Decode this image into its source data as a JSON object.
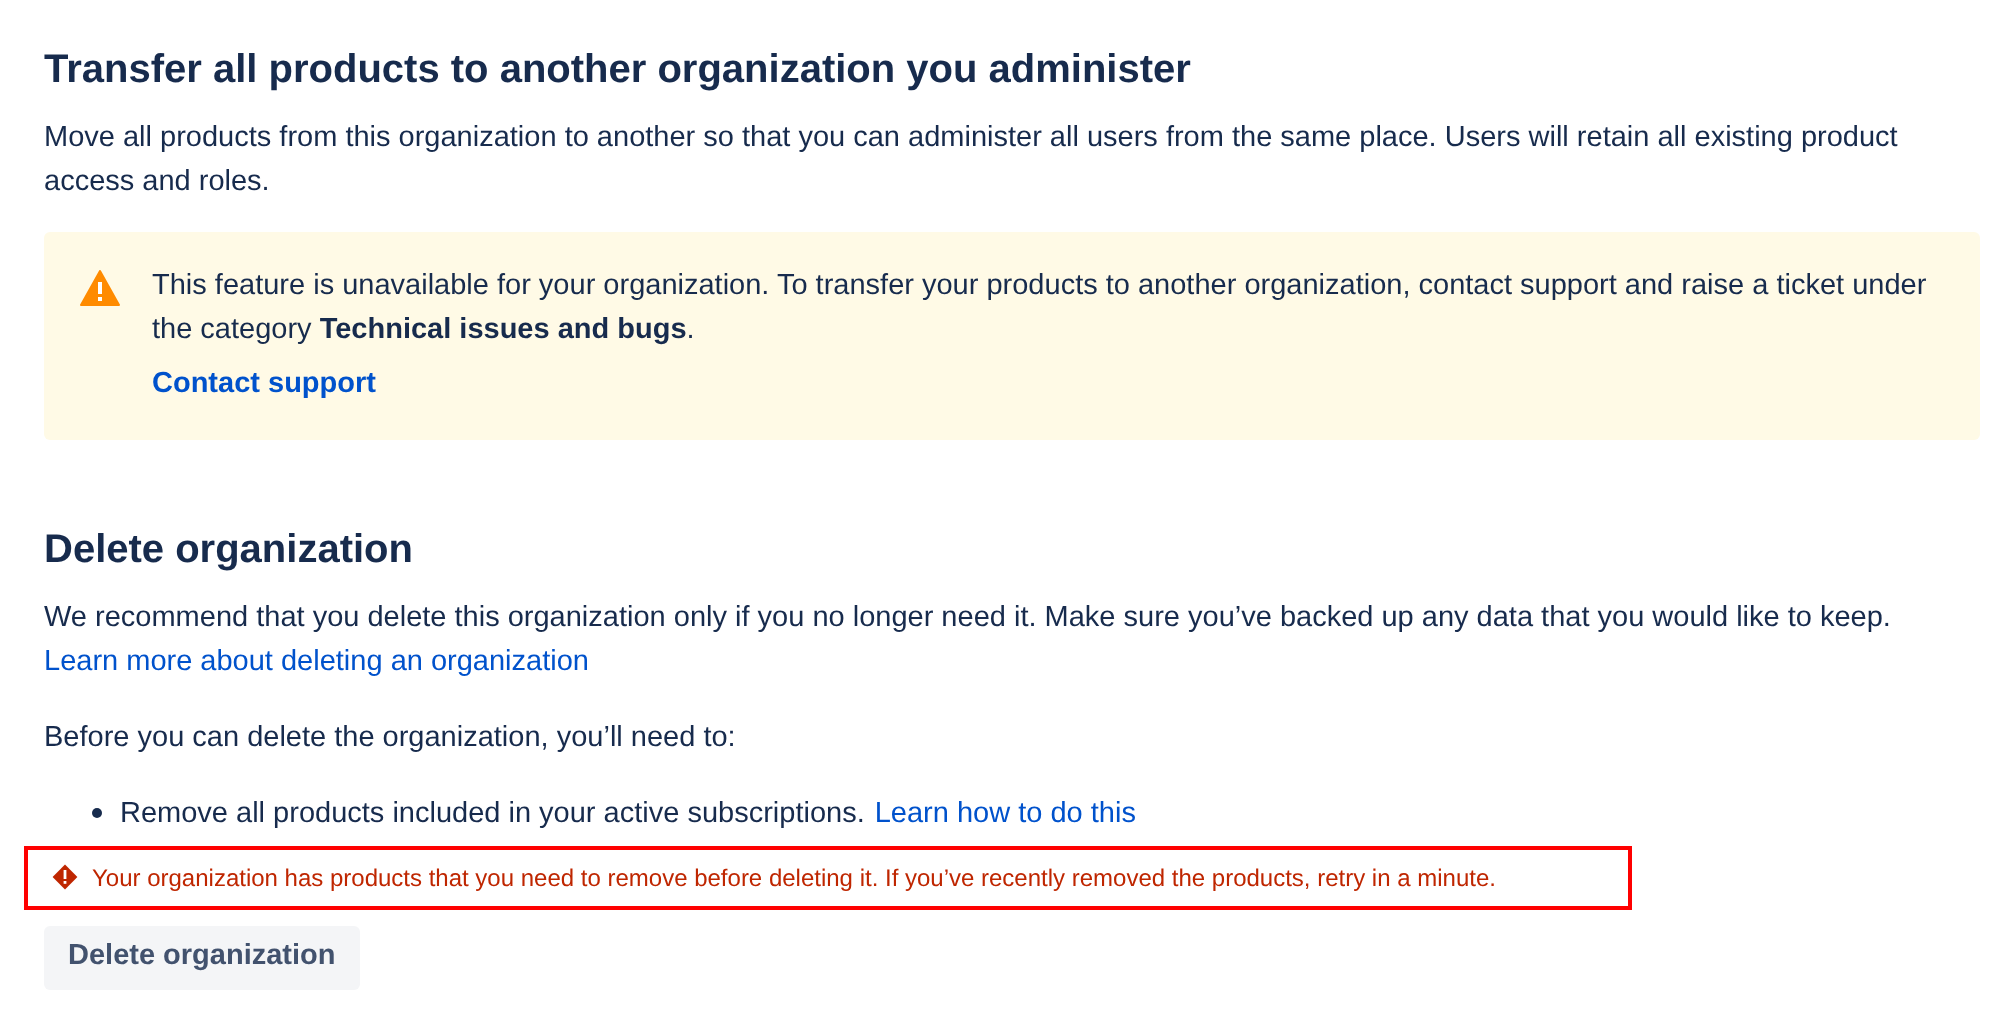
{
  "transfer": {
    "title": "Transfer all products to another organization you administer",
    "description": "Move all products from this organization to another so that you can administer all users from the same place. Users will retain all existing product access and roles.",
    "notice": {
      "kind": "warning",
      "text": "This feature is unavailable for your organization. To transfer your products to another organization, contact support and raise a ticket under the category **Technical issues and bugs**.",
      "link": "Contact support"
    }
  },
  "delete": {
    "title": "Delete organization",
    "description": "We recommend that you delete this organization only if you no longer need it. Make sure you’ve backed up any data that you would like to keep.",
    "link": "Learn more about deleting an organization",
    "requirements_intro": "Before you can delete the organization, you’ll need to:",
    "requirements": [
      {
        "text": "Remove all products included in your active subscriptions.",
        "link": "Learn how to do this"
      }
    ],
    "error": {
      "text": "Your organization has products that you need to remove before deleting it. If you’ve recently removed the products, retry in a minute.",
      "highlighted": true
    },
    "button": {
      "label": "Delete organization"
    }
  }
}
